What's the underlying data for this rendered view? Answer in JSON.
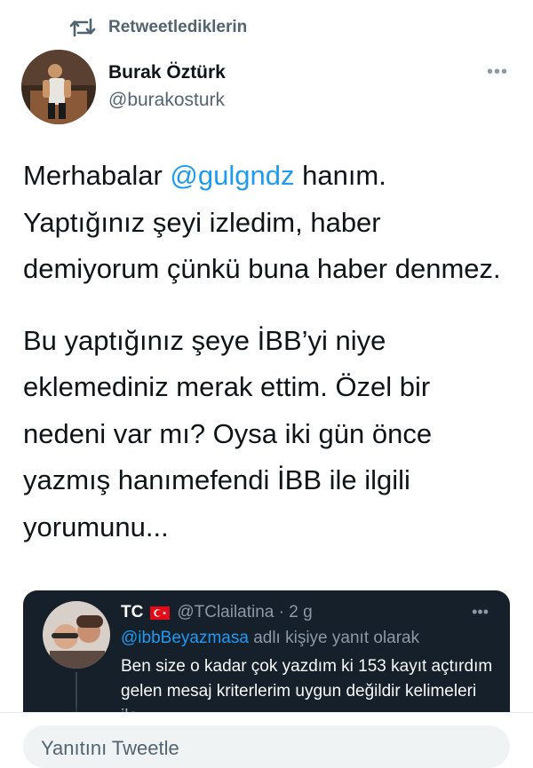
{
  "header": {
    "retweet_label": "Retweetlediklerin"
  },
  "author": {
    "name": "Burak Öztürk",
    "handle": "@burakosturk"
  },
  "tweet": {
    "p1_before": "Merhabalar ",
    "p1_mention": "@gulgndz",
    "p1_after": " hanım. Yaptığınız şeyi izledim, haber demiyorum çünkü buna haber denmez.",
    "p2": "Bu yaptığınız şeye İBB’yi niye eklemediniz merak ettim. Özel bir nedeni var mı? Oysa iki gün önce yazmış hanımefendi İBB ile ilgili yorumunu..."
  },
  "quote": {
    "name": "TC",
    "handle_time": "@TClailatina · 2 g",
    "reply_mention": "@ibbBeyazmasa",
    "reply_suffix": " adlı kişiye yanıt olarak",
    "text": "Ben size o kadar çok yazdım ki 153 kayıt açtırdım gelen mesaj kriterlerim uygun değildir kelimeleri ile..."
  },
  "reply_bar": {
    "placeholder": "Yanıtını Tweetle"
  },
  "colors": {
    "mention_blue": "#1d9bf0",
    "quote_bg": "#15202b",
    "muted": "#536471",
    "flag_red": "#e30a17"
  }
}
